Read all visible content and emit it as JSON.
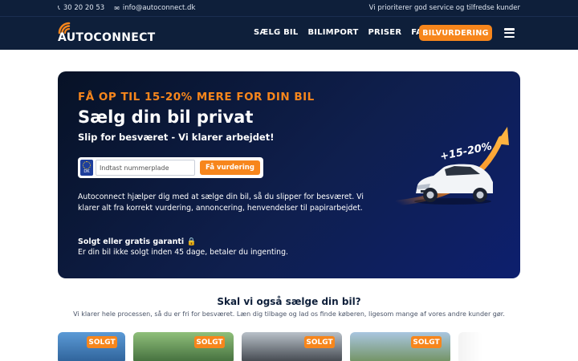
{
  "topbar": {
    "phone": "30 20 20 53",
    "email": "info@autoconnect.dk",
    "tagline": "Vi prioriterer god service og tilfredse kunder"
  },
  "header": {
    "logo_text": "AUTOCONNECT",
    "nav": [
      {
        "label": "SÆLG BIL"
      },
      {
        "label": "BILIMPORT"
      },
      {
        "label": "PRISER"
      },
      {
        "label": "FAQ"
      }
    ],
    "cta_label": "BILVURDERING"
  },
  "hero": {
    "kicker": "FÅ OP TIL 15-20% MERE FOR DIN BIL",
    "title": "Sælg din bil privat",
    "subtitle": "Slip for besværet - Vi klarer arbejdet!",
    "plate_country": "DK",
    "plate_placeholder": "Indtast nummerplade",
    "plate_button": "Få vurdering",
    "description": "Autoconnect hjælper dig med at sælge din bil, så du slipper for besværet. Vi klarer alt fra korrekt vurdering, annoncering, henvendelser til papirarbejdet.",
    "guarantee_title": "Solgt eller gratis garanti 🔒",
    "guarantee_text": "Er din bil ikke solgt inden 45 dage, betaler du ingenting.",
    "art_label": "+15-20%"
  },
  "section": {
    "title": "Skal vi også sælge din bil?",
    "subtitle": "Vi klarer hele processen, så du er fri for besværet. Læn dig tilbage og lad os finde køberen, ligesom mange af vores andre kunder gør."
  },
  "cards": [
    {
      "badge": "SOLGT"
    },
    {
      "badge": "SOLGT"
    },
    {
      "badge": "SOLGT"
    },
    {
      "badge": "SOLGT"
    }
  ],
  "colors": {
    "navy": "#0e1f3a",
    "accent": "#f7861c",
    "hero_blue": "#0d1f6e"
  }
}
